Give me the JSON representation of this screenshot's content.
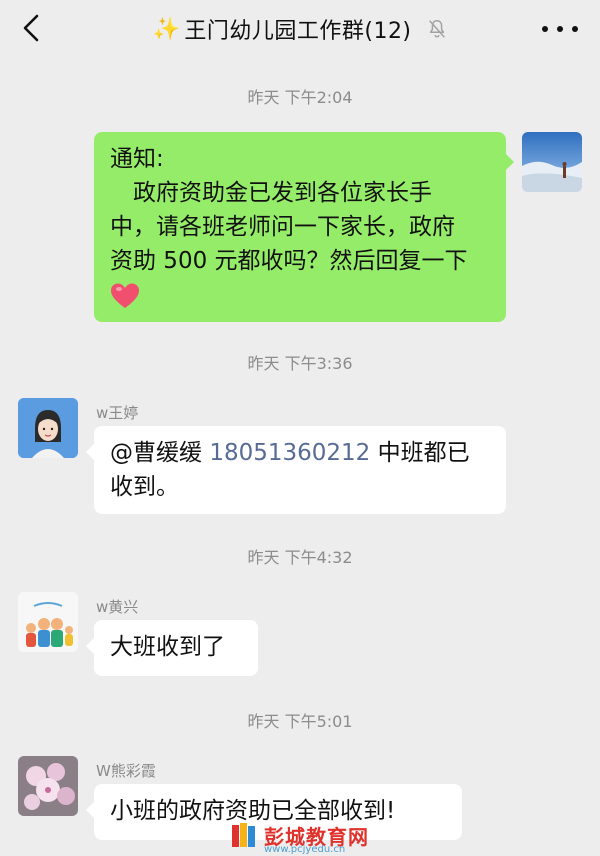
{
  "header": {
    "sparkle": "✨",
    "title": "王门幼儿园工作群(12)"
  },
  "messages": [
    {
      "timestamp": "昨天 下午2:04",
      "sender": "",
      "side": "right",
      "lines": [
        "通知:",
        "　政府资助金已发到各位家长手",
        "中，请各班老师问一下家长，政府",
        "资助 500 元都收吗？然后回复一下"
      ],
      "emoji": "heart"
    },
    {
      "timestamp": "昨天 下午3:36",
      "sender": "w王婷",
      "side": "left",
      "mention_name": "@曹缓缓",
      "mention_number": "18051360212",
      "line1_rest": "中班都已",
      "line2": "收到。"
    },
    {
      "timestamp": "昨天 下午4:32",
      "sender": "w黄兴",
      "side": "left",
      "text": "大班收到了"
    },
    {
      "timestamp": "昨天 下午5:01",
      "sender": "W熊彩霞",
      "side": "left",
      "text": "小班的政府资助已全部收到!"
    }
  ],
  "watermark": {
    "text": "彭城教育网",
    "url": "www.pcjyedu.cn"
  },
  "colors": {
    "background": "#ededed",
    "green_bubble": "#95ec69",
    "white_bubble": "#ffffff",
    "link": "#576b95",
    "heart": "#f0506e"
  }
}
